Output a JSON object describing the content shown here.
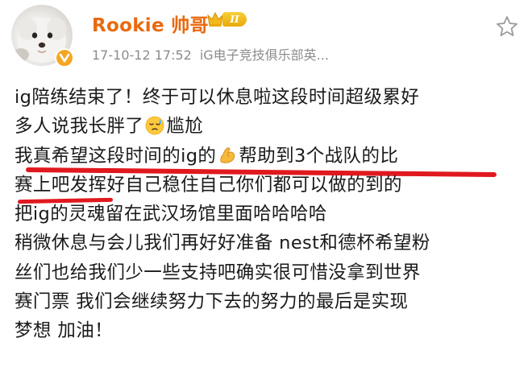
{
  "post": {
    "author": {
      "name": "Rookie 帅哥",
      "level": "II"
    },
    "meta": {
      "timestamp": "17-10-12 17:52",
      "source": "iG电子竞技俱乐部英..."
    },
    "content_lines": [
      "ig陪练结束了！终于可以休息啦这段时间超级累好",
      "多人说我长胖了",
      "尴尬",
      "我真希望这段时间的ig的",
      "帮助到3个战队的比",
      "赛上吧发挥好自己稳住自己你们都可以做的到的",
      "把ig的灵魂留在武汉场馆里面哈哈哈哈",
      "稍微休息与会儿我们再好好准备 nest和德杯希望粉",
      "丝们也给我们少一些支持吧确实很可惜没拿到世界",
      "赛门票 我们会继续努力下去的努力的最后是实现",
      "梦想 加油！"
    ],
    "emojis": [
      "sweat-face-icon",
      "flexed-biceps-icon"
    ],
    "annotation_color": "#e0191f",
    "name_color": "#e86a10"
  }
}
